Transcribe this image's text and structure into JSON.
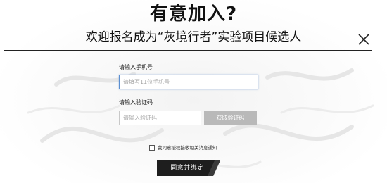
{
  "dialog": {
    "title": "有意加入?",
    "subtitle": "欢迎报名成为“灰境行者”实验项目候选人"
  },
  "form": {
    "phone_label": "请输入手机号",
    "phone_placeholder": "请填写11位手机号",
    "phone_value": "",
    "code_label": "请输入验证码",
    "code_placeholder": "请输入验证码",
    "code_value": "",
    "get_code_label": "获取验证码",
    "agree_text": "我同意授权接收相关消息通知",
    "agree_checked": false,
    "submit_label": "同意并绑定"
  },
  "icons": {
    "close": "close-icon"
  },
  "colors": {
    "text": "#111111",
    "active_input_border": "#5b8fd1",
    "disabled_button": "#b9b9b9",
    "submit_button": "#1e1e1e"
  }
}
